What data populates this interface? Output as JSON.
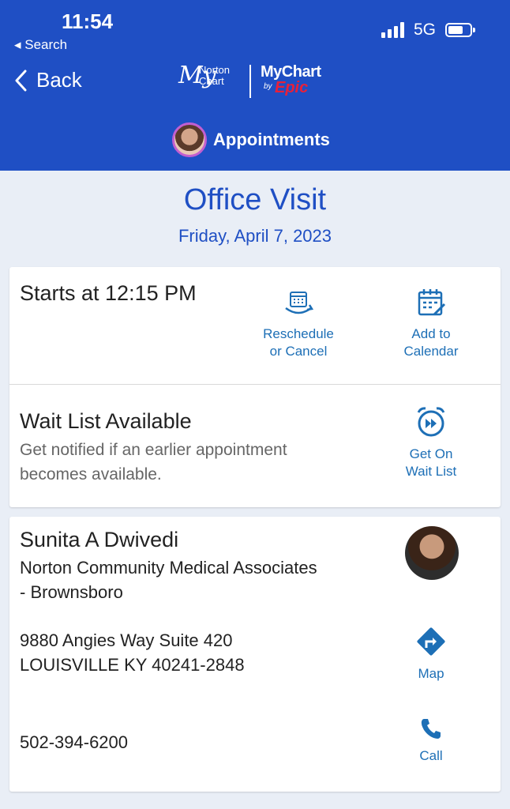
{
  "status_bar": {
    "time": "11:54",
    "back_label": "◂ Search",
    "network": "5G"
  },
  "nav": {
    "back_label": "Back",
    "logo": {
      "norton_initials": "My",
      "norton_text_1": "Norton",
      "norton_text_2": "Chart",
      "mychart": "MyChart",
      "by": "by",
      "epic": "Epic"
    },
    "page_label": "Appointments"
  },
  "visit": {
    "title": "Office Visit",
    "date": "Friday, April 7, 2023"
  },
  "timing": {
    "start_text": "Starts at 12:15 PM",
    "reschedule_label_1": "Reschedule",
    "reschedule_label_2": "or Cancel",
    "calendar_label_1": "Add to",
    "calendar_label_2": "Calendar"
  },
  "waitlist": {
    "title": "Wait List Available",
    "desc_1": "Get notified if an earlier appointment",
    "desc_2": "becomes available.",
    "action_1": "Get On",
    "action_2": "Wait List"
  },
  "provider": {
    "name": "Sunita A Dwivedi",
    "org_1": "Norton Community Medical Associates",
    "org_2": "- Brownsboro",
    "address_1": "9880 Angies Way Suite 420",
    "address_2": "LOUISVILLE KY 40241-2848",
    "phone": "502-394-6200",
    "map_label": "Map",
    "call_label": "Call"
  },
  "colors": {
    "header_blue": "#1f4fc4",
    "action_blue": "#1d6fb6",
    "background": "#e9eef6",
    "epic_red": "#e8203a"
  },
  "icons": {
    "reschedule": "calendar-cycle-icon",
    "add_calendar": "calendar-add-icon",
    "waitlist": "alarm-clock-icon",
    "map": "directions-icon",
    "call": "phone-icon"
  }
}
